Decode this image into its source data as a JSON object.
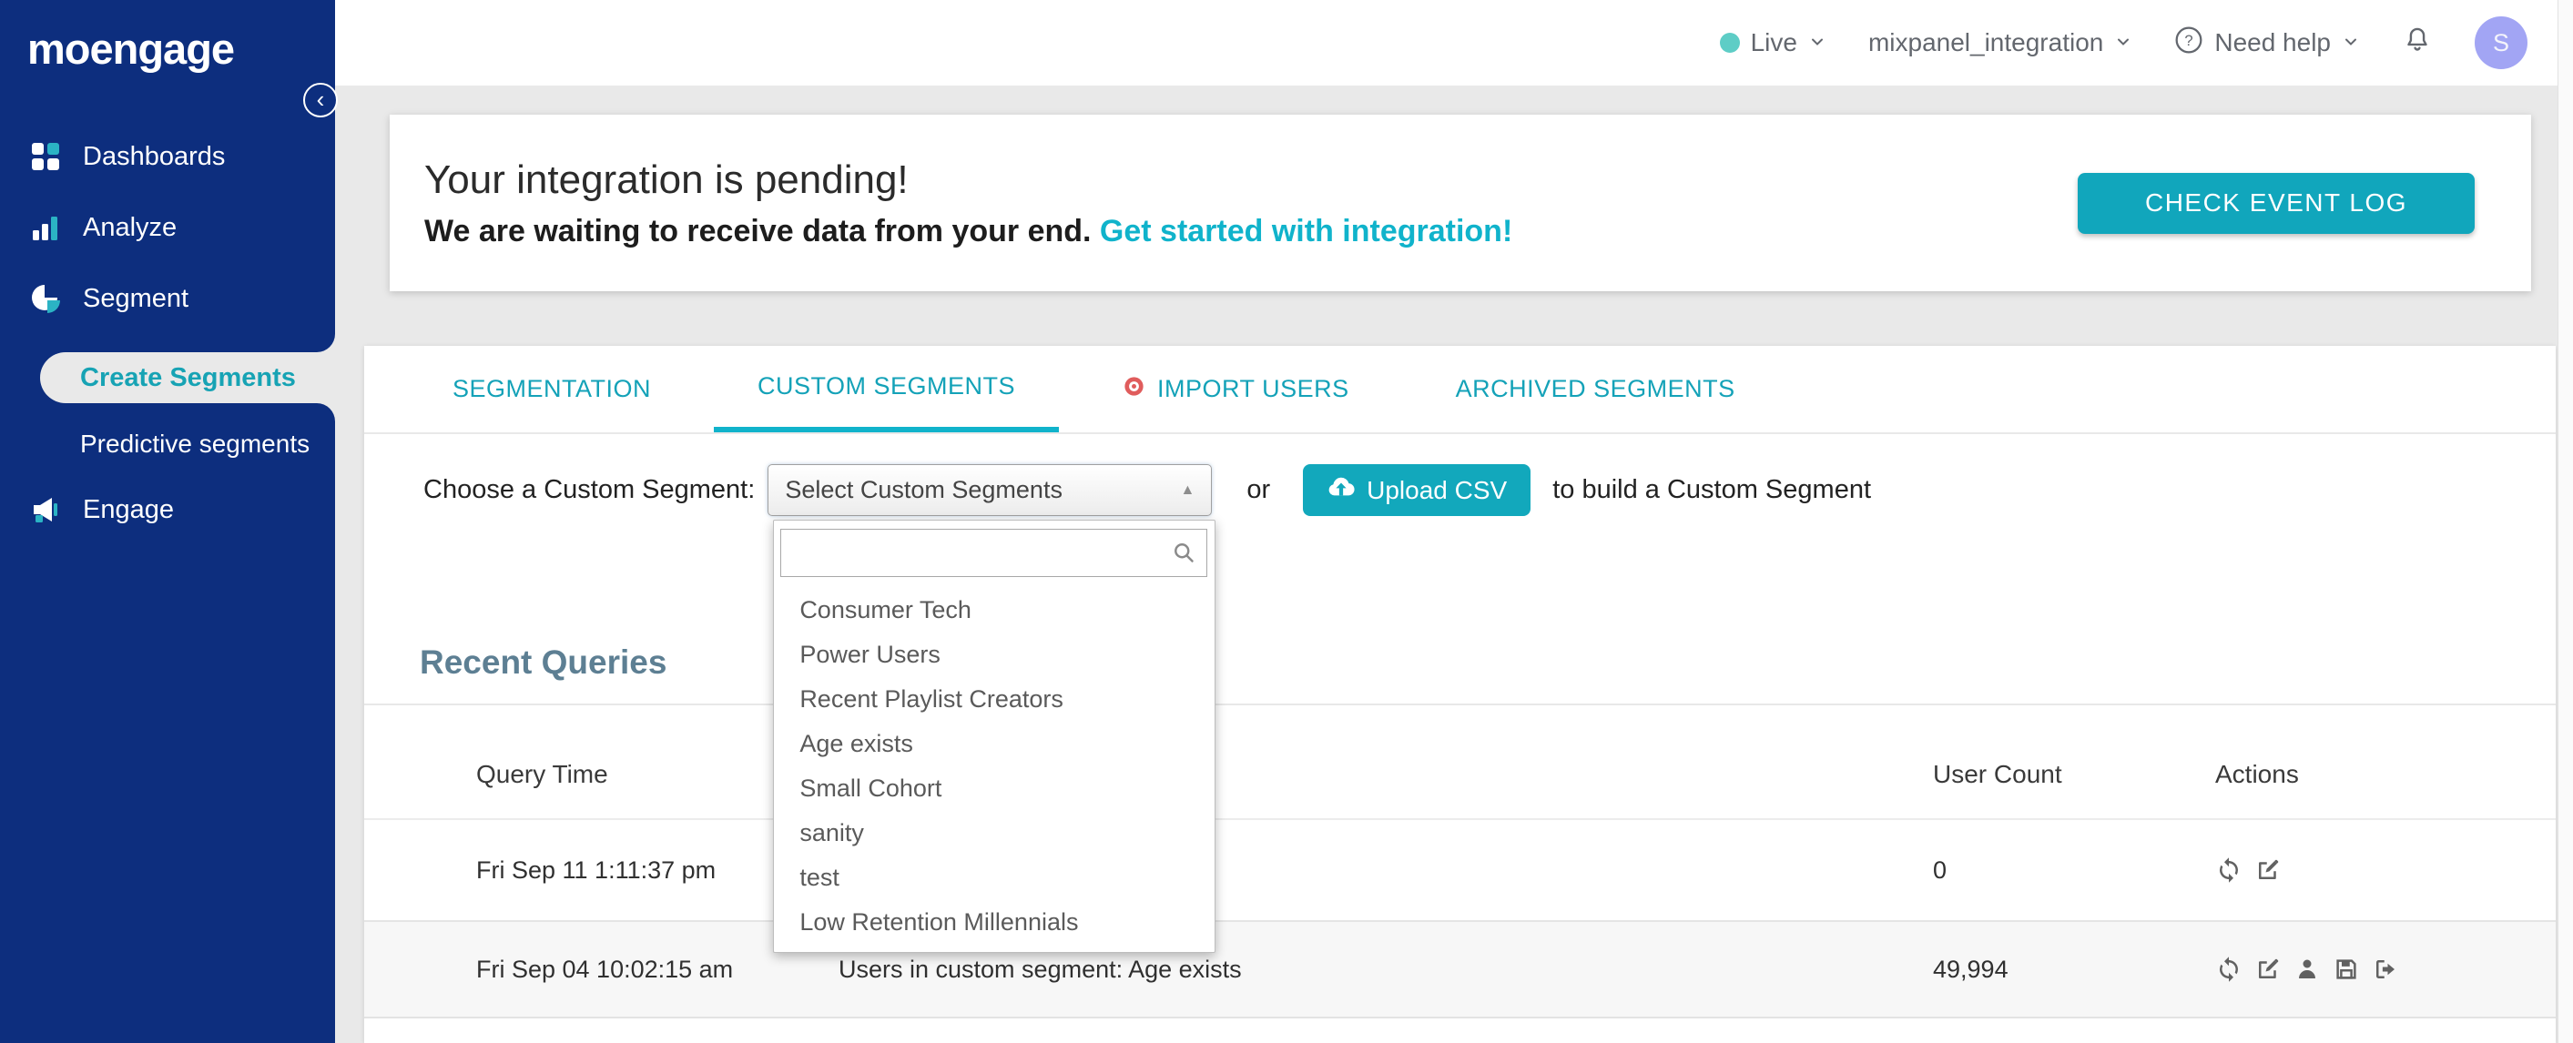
{
  "brand": {
    "logo_text": "moengage"
  },
  "sidebar": {
    "items": [
      {
        "label": "Dashboards",
        "icon": "dashboards-icon"
      },
      {
        "label": "Analyze",
        "icon": "analyze-icon"
      },
      {
        "label": "Segment",
        "icon": "segment-icon"
      },
      {
        "label": "Create Segments",
        "active": true
      },
      {
        "label": "Predictive segments"
      },
      {
        "label": "Engage",
        "icon": "engage-icon"
      }
    ],
    "collapse_icon": "chevron-left-icon"
  },
  "topbar": {
    "environment": "Live",
    "project": "mixpanel_integration",
    "help_label": "Need help",
    "avatar_initial": "S",
    "icons": [
      "live-dot-icon",
      "chevron-down-icon",
      "question-circle-icon",
      "bell-icon",
      "avatar"
    ]
  },
  "banner": {
    "title": "Your integration is pending!",
    "subtitle": "We are waiting to receive data from your end.",
    "link": "Get started with integration!",
    "button": "CHECK EVENT LOG"
  },
  "tabs": [
    {
      "label": "SEGMENTATION",
      "active": false
    },
    {
      "label": "CUSTOM SEGMENTS",
      "active": true
    },
    {
      "label": "IMPORT USERS",
      "active": false,
      "icon": "target-icon"
    },
    {
      "label": "ARCHIVED SEGMENTS",
      "active": false
    }
  ],
  "chooser": {
    "label": "Choose a Custom Segment:",
    "select_value": "Select Custom Segments",
    "or_text": "or",
    "upload_button": "Upload CSV",
    "upload_icon": "cloud-upload-icon",
    "suffix_text": "to build a Custom Segment",
    "dropdown": {
      "search_value": "",
      "search_icon": "search-icon",
      "options": [
        "Consumer Tech",
        "Power Users",
        "Recent Playlist Creators",
        "Age exists",
        "Small Cohort",
        "sanity",
        "test",
        "Low Retention Millennials"
      ]
    }
  },
  "recent_queries": {
    "title": "Recent Queries",
    "columns": [
      "Query Time",
      "",
      "User Count",
      "Actions"
    ],
    "rows": [
      {
        "query_time": "Fri Sep 11 1:11:37 pm",
        "description": "",
        "user_count": "0",
        "actions": [
          "refresh",
          "edit"
        ]
      },
      {
        "query_time": "Fri Sep 04 10:02:15 am",
        "description": "Users in custom segment: Age exists",
        "user_count": "49,994",
        "actions": [
          "refresh",
          "edit",
          "user",
          "save",
          "export"
        ]
      }
    ]
  },
  "colors": {
    "navy": "#0d2e7e",
    "accent_teal": "#13a5ba",
    "link_teal": "#10b3cb",
    "import_red": "#e05c5c",
    "live_dot": "#5ecdc6",
    "avatar_bg": "#a2a5f4",
    "heading_slate": "#5d7f93",
    "page_bg": "#e9e9e9",
    "row_alt_bg": "#f7f7f7"
  }
}
